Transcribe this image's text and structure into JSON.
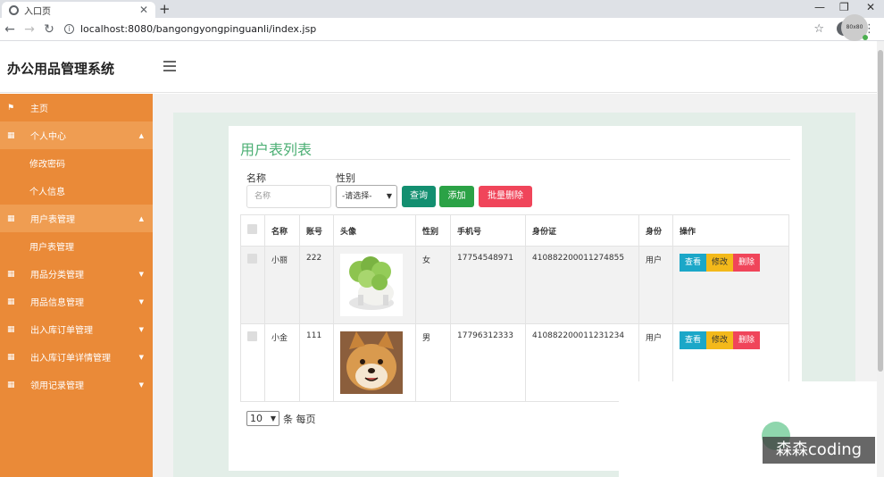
{
  "browser": {
    "tab_title": "入口页",
    "url": "localhost:8080/bangongyongpinguanli/index.jsp"
  },
  "app": {
    "title": "办公用品管理系统",
    "avatar_text": "80x80"
  },
  "sidebar": {
    "items": [
      {
        "label": "主页",
        "icon": "flag-icon"
      },
      {
        "label": "个人中心",
        "icon": "grid-icon",
        "expanded": true
      },
      {
        "label": "修改密码",
        "sub": true
      },
      {
        "label": "个人信息",
        "sub": true
      },
      {
        "label": "用户表管理",
        "icon": "grid-icon",
        "expanded": true
      },
      {
        "label": "用户表管理",
        "sub": true
      },
      {
        "label": "用品分类管理",
        "icon": "grid-icon"
      },
      {
        "label": "用品信息管理",
        "icon": "grid-icon"
      },
      {
        "label": "出入库订单管理",
        "icon": "grid-icon"
      },
      {
        "label": "出入库订单详情管理",
        "icon": "grid-icon"
      },
      {
        "label": "领用记录管理",
        "icon": "grid-icon"
      }
    ]
  },
  "page": {
    "title": "用户表列表",
    "search": {
      "name_label": "名称",
      "name_placeholder": "名称",
      "gender_label": "性别",
      "gender_selected": "-请选择-",
      "query_label": "查询",
      "add_label": "添加",
      "batch_delete_label": "批量删除"
    },
    "table": {
      "headers": [
        "名称",
        "账号",
        "头像",
        "性别",
        "手机号",
        "身份证",
        "身份",
        "操作"
      ],
      "rows": [
        {
          "name": "小丽",
          "account": "222",
          "avatar": "cabbage",
          "gender": "女",
          "phone": "17754548971",
          "id_card": "410882200011274855",
          "role": "用户"
        },
        {
          "name": "小金",
          "account": "111",
          "avatar": "shiba",
          "gender": "男",
          "phone": "17796312333",
          "id_card": "410882200011231234",
          "role": "用户"
        }
      ],
      "actions": {
        "view": "查看",
        "edit": "修改",
        "delete": "删除"
      }
    },
    "pager": {
      "page_size": "10",
      "suffix": "条 每页"
    }
  },
  "watermark": "森森coding",
  "colors": {
    "sidebar": "#ea8a38",
    "title_green": "#4caf74",
    "btn_query": "#138f70",
    "btn_add": "#2ba246",
    "btn_delete": "#f0455a",
    "op_view": "#1ba7c8",
    "op_edit": "#f3b91a",
    "op_delete": "#f0455a"
  }
}
